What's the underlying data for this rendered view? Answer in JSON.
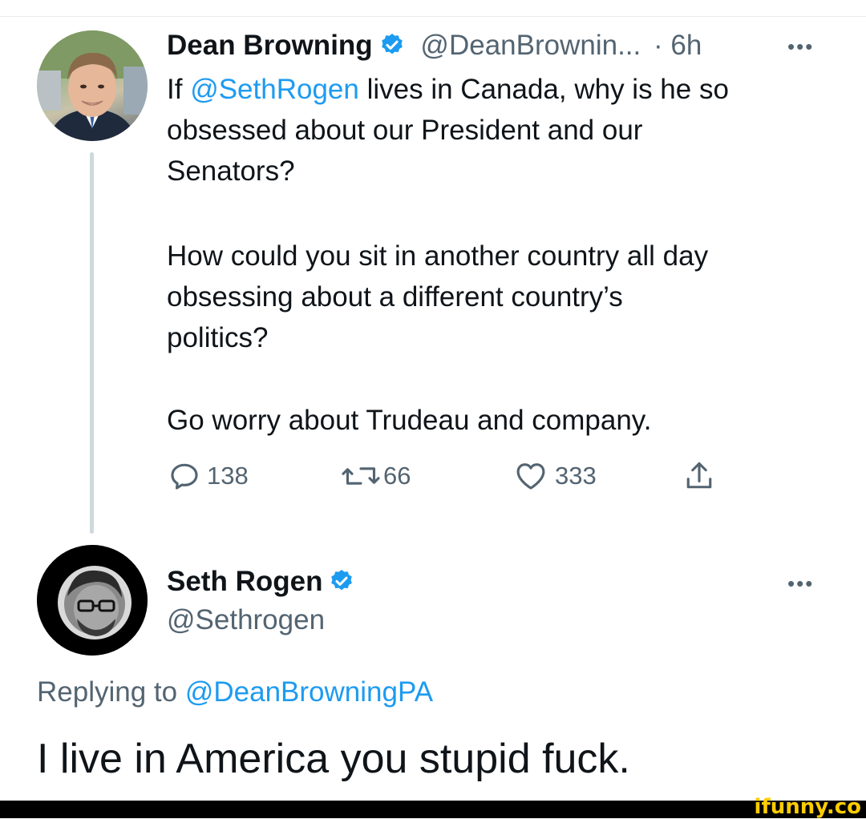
{
  "tweet": {
    "author_name": "Dean Browning",
    "author_handle": "@DeanBrownin...",
    "time": "· 6h",
    "more_icon": "more-dots-icon",
    "text_lines": [
      {
        "before": "If ",
        "mention": "@SethRogen",
        "after": " lives in Canada, why is he so"
      },
      "obsessed about our President and our",
      "Senators?",
      "How could you sit in another country all day",
      "obsessing about a different country’s",
      "politics?",
      "Go worry about Trudeau and company."
    ],
    "actions": {
      "replies": "138",
      "retweets": "66",
      "likes": "333"
    },
    "accent_color": "#1d9bf0"
  },
  "reply": {
    "author_name": "Seth Rogen",
    "author_handle": "@Sethrogen",
    "replying_label": "Replying to",
    "replying_handle": "@DeanBrowningPA",
    "text": "I live in America you stupid fuck."
  },
  "watermark": "ifunny.co"
}
